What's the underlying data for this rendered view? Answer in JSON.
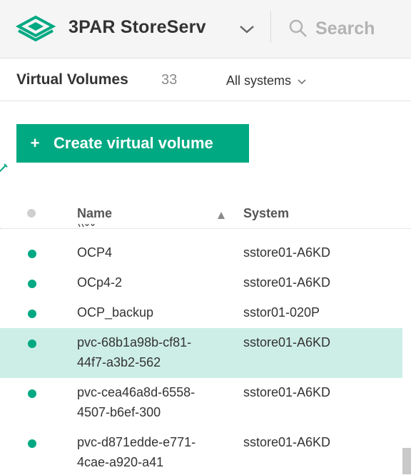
{
  "header": {
    "app_title": "3PAR StoreServ",
    "search_label": "Search",
    "icons": {
      "logo": "hpe-storeserv-logo",
      "title_dropdown": "chevron-down-icon",
      "search": "search-icon"
    }
  },
  "subheader": {
    "title": "Virtual Volumes",
    "count": "33",
    "systems_filter": "All systems"
  },
  "actions": {
    "create_plus": "+",
    "create_label": "Create virtual volume"
  },
  "table": {
    "columns": {
      "name": "Name",
      "system": "System"
    },
    "sort": "ascending",
    "rows": [
      {
        "name": "OCP4",
        "system": "sstore01-A6KD",
        "status": "normal",
        "selected": false
      },
      {
        "name": "OCp4-2",
        "system": "sstore01-A6KD",
        "status": "normal",
        "selected": false
      },
      {
        "name": "OCP_backup",
        "system": "sstor01-020P",
        "status": "normal",
        "selected": false
      },
      {
        "name_line1": "pvc-68b1a98b-cf81-",
        "name_line2": "44f7-a3b2-562",
        "system": "sstore01-A6KD",
        "status": "normal",
        "selected": true
      },
      {
        "name_line1": "pvc-cea46a8d-6558-",
        "name_line2": "4507-b6ef-300",
        "system": "sstore01-A6KD",
        "status": "normal",
        "selected": false
      },
      {
        "name_line1": "pvc-d871edde-e771-",
        "name_line2": "4cae-a920-a41",
        "system": "sstore01-A6KD",
        "status": "normal",
        "selected": false
      }
    ]
  },
  "colors": {
    "accent": "#01a982",
    "selected_row": "#cdeee6",
    "header_bg": "#f5f5f5"
  }
}
